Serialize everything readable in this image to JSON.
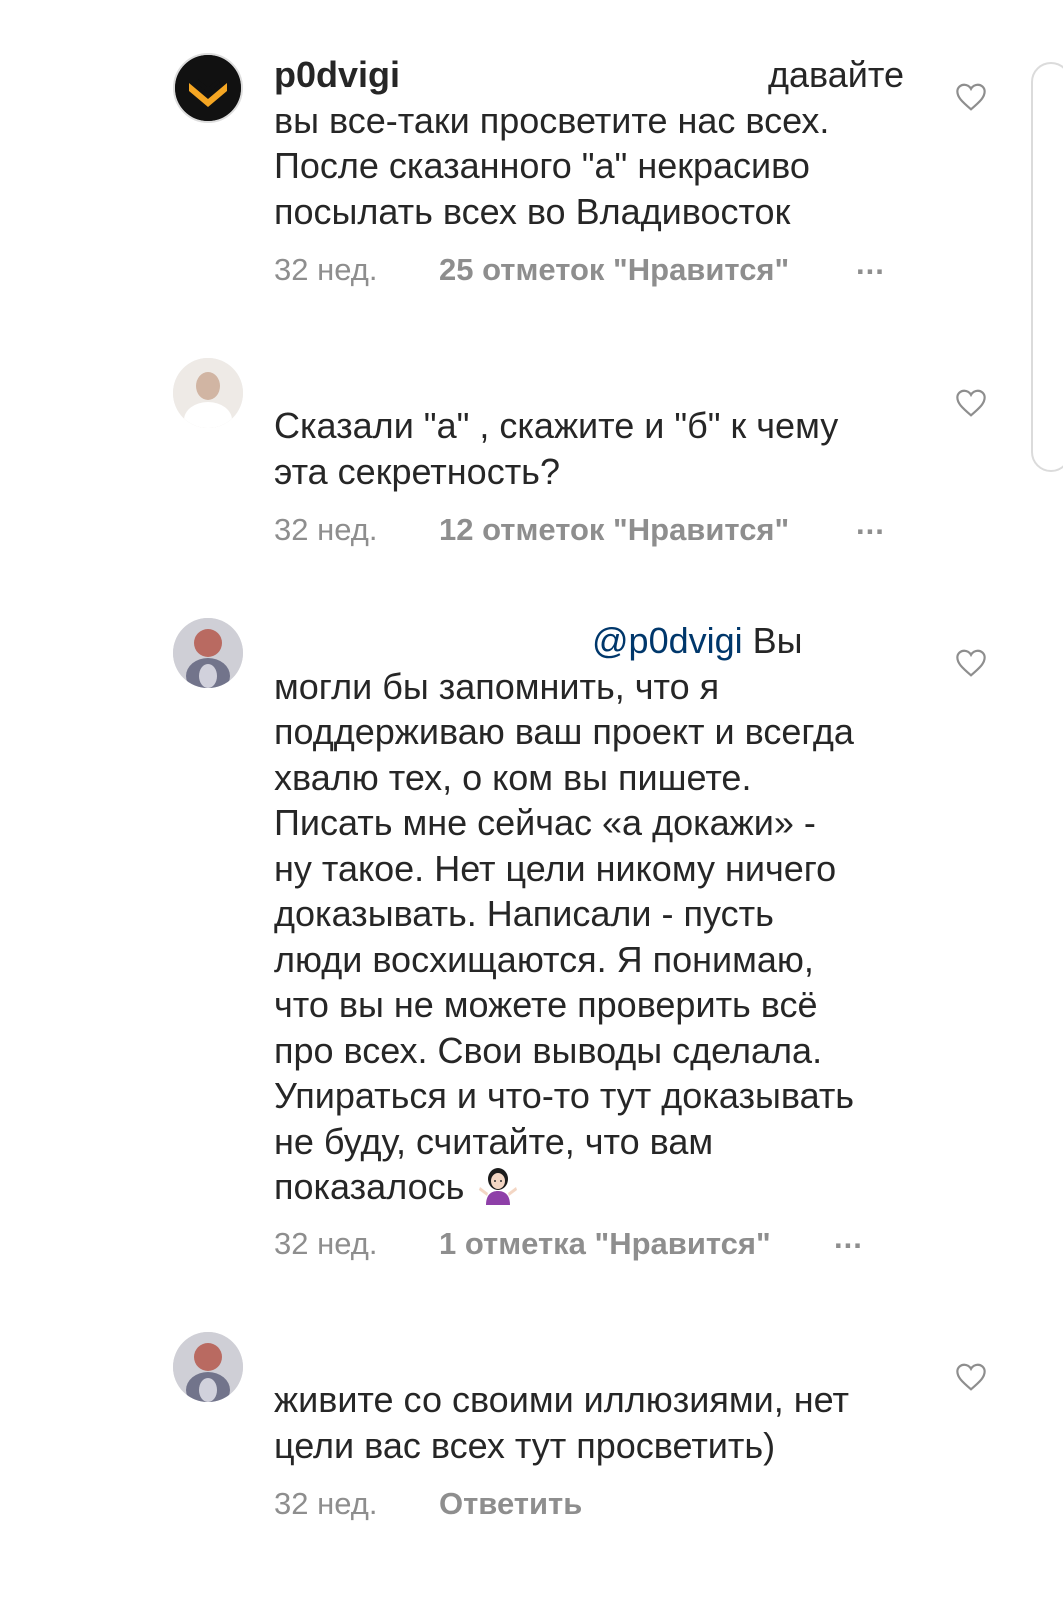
{
  "comments": [
    {
      "username": "p0dvigi",
      "line1_tail": "давайте",
      "lines": [
        "вы все-таки просветите нас всех.",
        "После сказанного \"а\" некрасиво",
        "посылать всех во Владивосток"
      ],
      "time": "32 нед.",
      "likes": "25 отметок \"Нравится\"",
      "more": "..."
    },
    {
      "lines": [
        "Сказали \"а\" , скажите и \"б\" к чему",
        "эта секретность?"
      ],
      "time": "32 нед.",
      "likes": "12 отметок \"Нравится\"",
      "more": "..."
    },
    {
      "mention": "@p0dvigi",
      "line1_tail": "Вы",
      "lines": [
        "могли бы запомнить, что я",
        "поддерживаю ваш проект и всегда",
        "хвалю тех, о ком вы пишете.",
        "Писать мне сейчас «а докажи» -",
        "ну такое. Нет цели никому ничего",
        "доказывать. Написали - пусть",
        "люди восхищаются. Я понимаю,",
        "что вы не можете проверить всё",
        "про всех. Свои выводы сделала.",
        "Упираться и что-то тут доказывать",
        "не буду, считайте, что вам"
      ],
      "last_line": "показалось",
      "emoji": "woman-shrugging-emoji",
      "time": "32 нед.",
      "likes": "1 отметка \"Нравится\"",
      "more": "..."
    },
    {
      "lines": [
        "живите со своими иллюзиями, нет",
        "цели вас всех тут просветить)"
      ],
      "time": "32 нед.",
      "reply": "Ответить"
    }
  ],
  "icons": {
    "like": "heart-outline-icon",
    "avatar_logo": "p0dvigi-logo-icon"
  },
  "colors": {
    "text": "#262626",
    "meta": "#8e8e8e",
    "mention": "#00376b",
    "avatar_bg": "#111111",
    "logo": "#f5a623"
  }
}
